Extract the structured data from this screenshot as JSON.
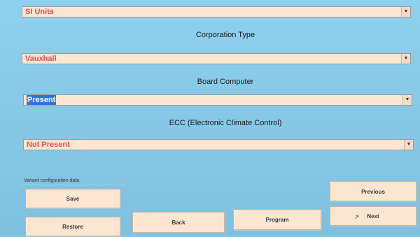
{
  "fields": {
    "units": {
      "value": "SI Units"
    },
    "corporation_type": {
      "label": "Corporation Type",
      "value": "Vauxhall"
    },
    "board_computer": {
      "label": "Board Computer",
      "value": "Present"
    },
    "ecc": {
      "label": "ECC (Electronic Climate Control)",
      "value": "Not Present"
    }
  },
  "section": {
    "label": "Variant configuration data"
  },
  "buttons": {
    "save": "Save",
    "restore": "Restore",
    "back": "Back",
    "program": "Program",
    "previous": "Previous",
    "next": "Next"
  },
  "icons": {
    "dropdown": "chevron-down-icon",
    "cursor": "mouse-pointer-icon"
  },
  "colors": {
    "background": "#8ccbe8",
    "field_bg": "#fce6d1",
    "field_text": "#d8505a",
    "selection": "#2f74d6"
  }
}
